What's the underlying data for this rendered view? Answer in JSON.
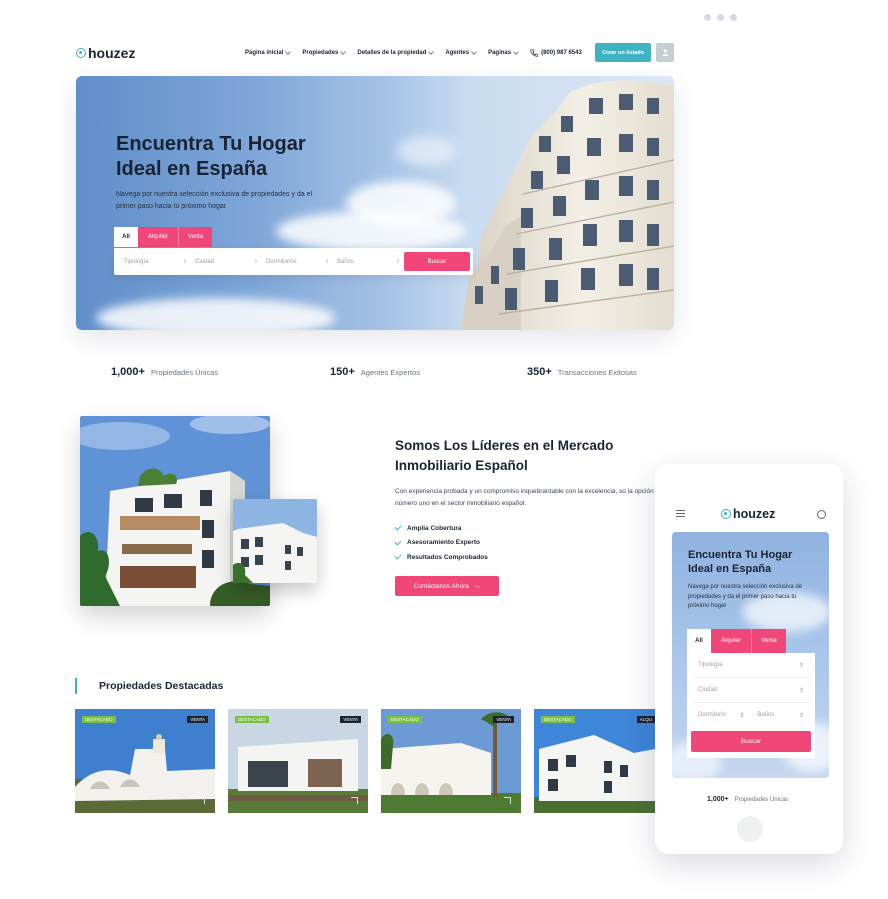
{
  "brand": {
    "name": "houzez",
    "accent": "#3fb3bf",
    "pink": "#f0467a"
  },
  "nav": {
    "items": [
      {
        "label": "Página inicial"
      },
      {
        "label": "Propiedades"
      },
      {
        "label": "Detalles de la propiedad"
      },
      {
        "label": "Agentes"
      },
      {
        "label": "Paginas"
      }
    ],
    "phone": "(800) 987 6543",
    "cta": "Crear un listado"
  },
  "hero": {
    "title": "Encuentra Tu Hogar Ideal en España",
    "subtitle": "Navega por nuestra selección exclusiva de propiedades y da el primer paso hacia tu próximo hogar",
    "tabs": [
      "All",
      "Alquiler",
      "Venta"
    ],
    "fields": [
      "Tipología",
      "Ciudad",
      "Dormitorios",
      "Baños"
    ],
    "search_button": "Buscar"
  },
  "stats": [
    {
      "value": "1,000+",
      "label": "Propiedades Únicas"
    },
    {
      "value": "150+",
      "label": "Agentes Expertos"
    },
    {
      "value": "350+",
      "label": "Transacciones Exitosas"
    }
  ],
  "about": {
    "title": "Somos Los Líderes en el Mercado Inmobiliario Español",
    "text": "Con experiencia probada y un compromiso inquebrantable con la excelencia, so la opción número uno en el sector inmobiliario español.",
    "checks": [
      "Amplia Cobertura",
      "Asesoramiento Experto",
      "Resultados Comprobados"
    ],
    "button": "Contáctanos Ahora"
  },
  "featured": {
    "title": "Propiedades Destacadas",
    "cards": [
      {
        "badge": "DESTACADO",
        "status": "VENTA"
      },
      {
        "badge": "DESTACADO",
        "status": "VENTA"
      },
      {
        "badge": "DESTACADO",
        "status": "VENTA"
      },
      {
        "badge": "DESTACADO",
        "status": "ALQU"
      }
    ]
  },
  "mobile": {
    "title": "Encuentra Tu Hogar Ideal en España",
    "subtitle": "Navega por nuestra selección exclusiva de propiedades y da el primer paso hacia tu próximo hogar",
    "tabs": [
      "All",
      "Alquiler",
      "Venta"
    ],
    "fields": [
      "Tipología",
      "Ciudad",
      "Dormitorio",
      "Baños"
    ],
    "search_button": "Buscar",
    "stat_value": "1,000+",
    "stat_label": "Propiedades Únicas"
  }
}
